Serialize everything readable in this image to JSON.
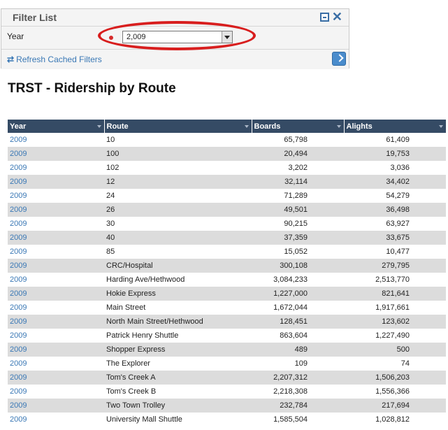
{
  "filter": {
    "title": "Filter List",
    "year_label": "Year",
    "year_value": "2,009",
    "refresh_label": "Refresh Cached Filters"
  },
  "page": {
    "title": "TRST - Ridership by Route"
  },
  "table": {
    "headers": [
      "Year",
      "Route",
      "Boards",
      "Alights"
    ],
    "rows": [
      [
        "2009",
        "10",
        "65,798",
        "61,409"
      ],
      [
        "2009",
        "100",
        "20,494",
        "19,753"
      ],
      [
        "2009",
        "102",
        "3,202",
        "3,036"
      ],
      [
        "2009",
        "12",
        "32,114",
        "34,402"
      ],
      [
        "2009",
        "24",
        "71,289",
        "54,279"
      ],
      [
        "2009",
        "26",
        "49,501",
        "36,498"
      ],
      [
        "2009",
        "30",
        "90,215",
        "63,927"
      ],
      [
        "2009",
        "40",
        "37,359",
        "33,675"
      ],
      [
        "2009",
        "85",
        "15,052",
        "10,477"
      ],
      [
        "2009",
        "CRC/Hospital",
        "300,108",
        "279,795"
      ],
      [
        "2009",
        "Harding Ave/Hethwood",
        "3,084,233",
        "2,513,770"
      ],
      [
        "2009",
        "Hokie Express",
        "1,227,000",
        "821,641"
      ],
      [
        "2009",
        "Main Street",
        "1,672,044",
        "1,917,661"
      ],
      [
        "2009",
        "North Main Street/Hethwood",
        "128,451",
        "123,602"
      ],
      [
        "2009",
        "Patrick Henry Shuttle",
        "863,604",
        "1,227,490"
      ],
      [
        "2009",
        "Shopper Express",
        "489",
        "500"
      ],
      [
        "2009",
        "The Explorer",
        "109",
        "74"
      ],
      [
        "2009",
        "Tom's Creek A",
        "2,207,312",
        "1,506,203"
      ],
      [
        "2009",
        "Tom's Creek B",
        "2,218,308",
        "1,556,366"
      ],
      [
        "2009",
        "Two Town Trolley",
        "232,784",
        "217,694"
      ],
      [
        "2009",
        "University Mall Shuttle",
        "1,585,504",
        "1,028,812"
      ]
    ]
  }
}
